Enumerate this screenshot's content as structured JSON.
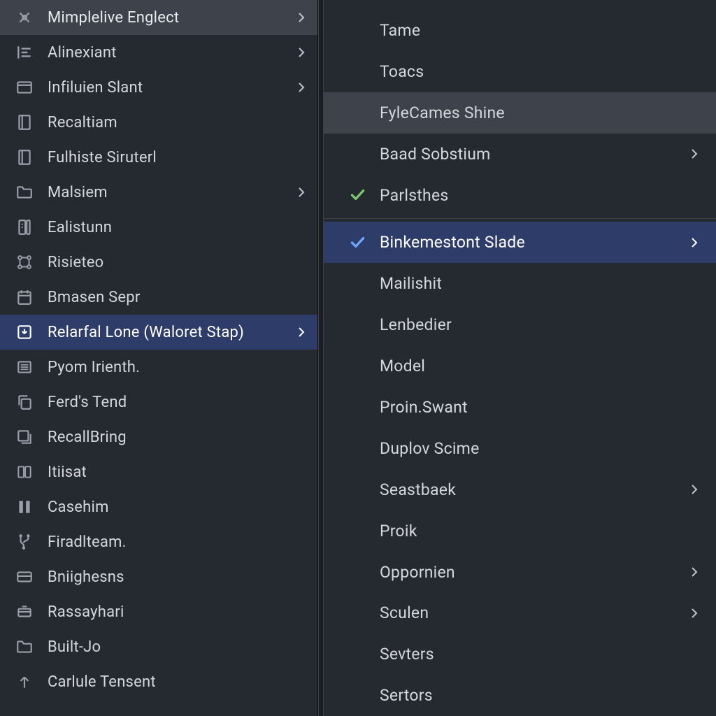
{
  "left_menu": {
    "items": [
      {
        "label": "Mimplelive Englect",
        "icon": "x-tool",
        "submenu": true,
        "state": "header"
      },
      {
        "label": "Alinexiant",
        "icon": "align-left",
        "submenu": true
      },
      {
        "label": "Infiluien Slant",
        "icon": "window",
        "submenu": true
      },
      {
        "label": "Recaltiam",
        "icon": "book"
      },
      {
        "label": "Fulhiste Siruterl",
        "icon": "book"
      },
      {
        "label": "Malsiem",
        "icon": "folder",
        "submenu": true
      },
      {
        "label": "Ealistunn",
        "icon": "server"
      },
      {
        "label": "Risieteo",
        "icon": "nodes"
      },
      {
        "label": "Bmasen Sepr",
        "icon": "calendar"
      },
      {
        "label": "Relarfal Lone (Waloret Stap)",
        "icon": "download-box",
        "submenu": true,
        "state": "selected"
      },
      {
        "label": "Pyom Irienth.",
        "icon": "list"
      },
      {
        "label": "Ferd's Tend",
        "icon": "copy"
      },
      {
        "label": "RecallBring",
        "icon": "stack"
      },
      {
        "label": "Itiisat",
        "icon": "files"
      },
      {
        "label": "Casehim",
        "icon": "columns"
      },
      {
        "label": "Firadlteam.",
        "icon": "branch"
      },
      {
        "label": "Bniighesns",
        "icon": "card"
      },
      {
        "label": "Rassayhari",
        "icon": "drawer"
      },
      {
        "label": "Built-Jo",
        "icon": "folder"
      },
      {
        "label": "Carlule Tensent",
        "icon": "arrow-up"
      }
    ]
  },
  "right_menu": {
    "items": [
      {
        "label": "Tame"
      },
      {
        "label": "Toacs"
      },
      {
        "label": "FyleCames Shine",
        "state": "hover",
        "indent": true
      },
      {
        "label": "Baad Sobstium",
        "submenu": true,
        "indent": true
      },
      {
        "label": "Parlsthes",
        "check": "green"
      },
      {
        "sep": true
      },
      {
        "label": "Binkemestont Slade",
        "check": "blue",
        "submenu": true,
        "state": "selected"
      },
      {
        "label": "Mailishit"
      },
      {
        "label": "Lenbedier"
      },
      {
        "label": "Model"
      },
      {
        "label": "Proin.Swant"
      },
      {
        "label": "Duplov Scime"
      },
      {
        "label": "Seastbaek",
        "submenu": true
      },
      {
        "label": "Proik"
      },
      {
        "label": "Oppornien",
        "submenu": true
      },
      {
        "label": "Sculen",
        "submenu": true
      },
      {
        "label": "Sevters"
      },
      {
        "label": "Sertors"
      }
    ]
  }
}
